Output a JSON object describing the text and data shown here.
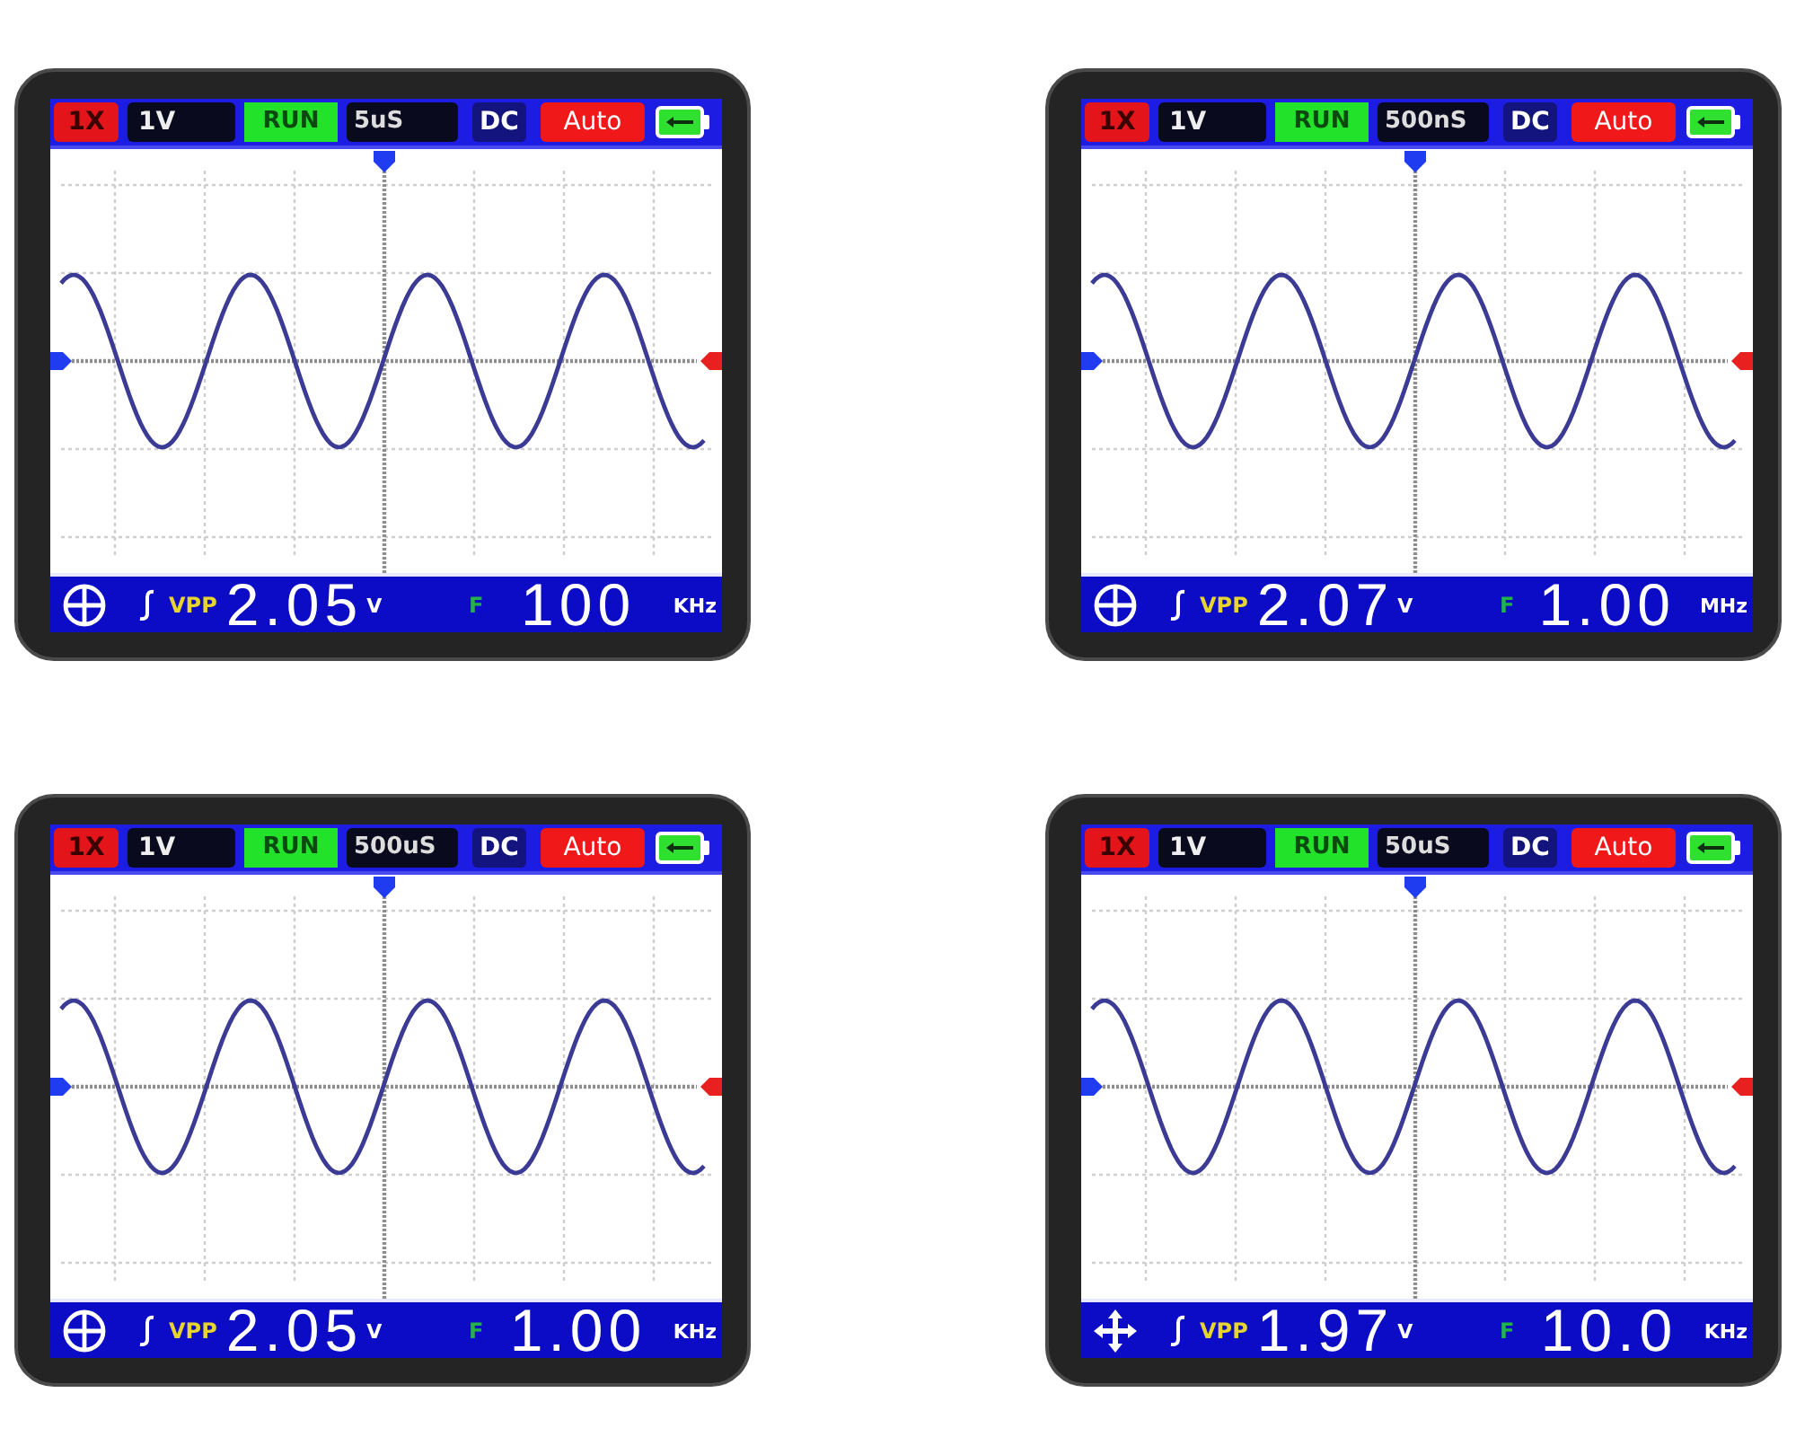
{
  "scopes": [
    {
      "top_bar": {
        "probe": "1X",
        "volts_per_div": "1V",
        "run_state": "RUN",
        "time_per_div": "5uS",
        "coupling": "DC",
        "trigger_mode": "Auto"
      },
      "bottom_bar": {
        "kind": "crosshair",
        "vpp_label": "VPP",
        "vpp_value": "2.05",
        "vpp_unit": "V",
        "freq_label": "F",
        "freq_value": "100",
        "freq_unit": "KHz"
      }
    },
    {
      "top_bar": {
        "probe": "1X",
        "volts_per_div": "1V",
        "run_state": "RUN",
        "time_per_div": "500nS",
        "coupling": "DC",
        "trigger_mode": "Auto"
      },
      "bottom_bar": {
        "kind": "crosshair",
        "vpp_label": "VPP",
        "vpp_value": "2.07",
        "vpp_unit": "V",
        "freq_label": "F",
        "freq_value": "1.00",
        "freq_unit": "MHz"
      }
    },
    {
      "top_bar": {
        "probe": "1X",
        "volts_per_div": "1V",
        "run_state": "RUN",
        "time_per_div": "500uS",
        "coupling": "DC",
        "trigger_mode": "Auto"
      },
      "bottom_bar": {
        "kind": "crosshair",
        "vpp_label": "VPP",
        "vpp_value": "2.05",
        "vpp_unit": "V",
        "freq_label": "F",
        "freq_value": "1.00",
        "freq_unit": "KHz"
      }
    },
    {
      "top_bar": {
        "probe": "1X",
        "volts_per_div": "1V",
        "run_state": "RUN",
        "time_per_div": "50uS",
        "coupling": "DC",
        "trigger_mode": "Auto"
      },
      "bottom_bar": {
        "kind": "move",
        "vpp_label": "VPP",
        "vpp_value": "1.97",
        "vpp_unit": "V",
        "freq_label": "F",
        "freq_value": "10.0",
        "freq_unit": "KHz"
      }
    }
  ]
}
